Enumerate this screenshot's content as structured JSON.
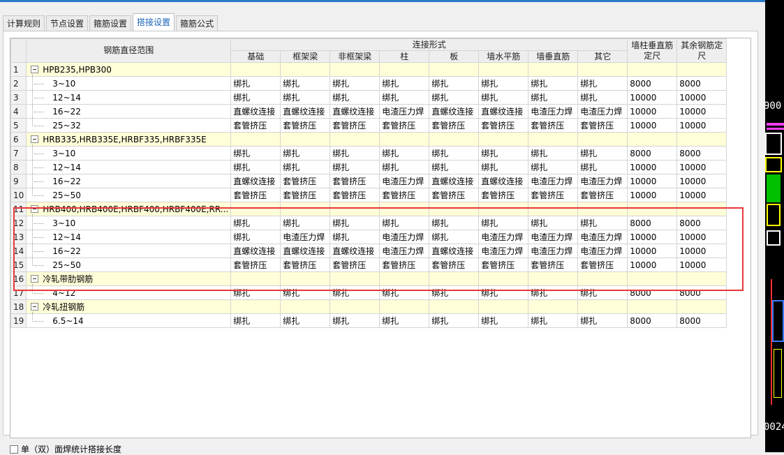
{
  "tabs": [
    {
      "label": "计算规则",
      "active": false
    },
    {
      "label": "节点设置",
      "active": false
    },
    {
      "label": "箍筋设置",
      "active": false
    },
    {
      "label": "搭接设置",
      "active": true
    },
    {
      "label": "箍筋公式",
      "active": false
    }
  ],
  "table": {
    "header": {
      "range": "钢筋直径范围",
      "group": "连接形式",
      "conn_cols": [
        "基础",
        "框架梁",
        "非框架梁",
        "柱",
        "板",
        "墙水平筋",
        "墙垂直筋",
        "其它"
      ],
      "len1": "墙柱垂直筋定尺",
      "len2": "其余钢筋定尺"
    },
    "rows": [
      {
        "n": "1",
        "type": "group",
        "label": "HPB235,HPB300"
      },
      {
        "n": "2",
        "type": "item",
        "label": "3~10",
        "cells": [
          "绑扎",
          "绑扎",
          "绑扎",
          "绑扎",
          "绑扎",
          "绑扎",
          "绑扎",
          "绑扎",
          "8000",
          "8000"
        ]
      },
      {
        "n": "3",
        "type": "item",
        "label": "12~14",
        "cells": [
          "绑扎",
          "绑扎",
          "绑扎",
          "绑扎",
          "绑扎",
          "绑扎",
          "绑扎",
          "绑扎",
          "10000",
          "10000"
        ]
      },
      {
        "n": "4",
        "type": "item",
        "label": "16~22",
        "cells": [
          "直螺纹连接",
          "直螺纹连接",
          "直螺纹连接",
          "电渣压力焊",
          "直螺纹连接",
          "直螺纹连接",
          "电渣压力焊",
          "电渣压力焊",
          "10000",
          "10000"
        ]
      },
      {
        "n": "5",
        "type": "item",
        "label": "25~32",
        "cells": [
          "套管挤压",
          "套管挤压",
          "套管挤压",
          "套管挤压",
          "套管挤压",
          "套管挤压",
          "套管挤压",
          "套管挤压",
          "10000",
          "10000"
        ]
      },
      {
        "n": "6",
        "type": "group",
        "label": "HRB335,HRB335E,HRBF335,HRBF335E"
      },
      {
        "n": "7",
        "type": "item",
        "label": "3~10",
        "cells": [
          "绑扎",
          "绑扎",
          "绑扎",
          "绑扎",
          "绑扎",
          "绑扎",
          "绑扎",
          "绑扎",
          "8000",
          "8000"
        ]
      },
      {
        "n": "8",
        "type": "item",
        "label": "12~14",
        "cells": [
          "绑扎",
          "绑扎",
          "绑扎",
          "绑扎",
          "绑扎",
          "绑扎",
          "绑扎",
          "绑扎",
          "10000",
          "10000"
        ]
      },
      {
        "n": "9",
        "type": "item",
        "label": "16~22",
        "cells": [
          "直螺纹连接",
          "套管挤压",
          "套管挤压",
          "电渣压力焊",
          "直螺纹连接",
          "直螺纹连接",
          "电渣压力焊",
          "电渣压力焊",
          "10000",
          "10000"
        ]
      },
      {
        "n": "10",
        "type": "item",
        "label": "25~50",
        "cells": [
          "套管挤压",
          "套管挤压",
          "套管挤压",
          "套管挤压",
          "套管挤压",
          "套管挤压",
          "套管挤压",
          "套管挤压",
          "10000",
          "10000"
        ]
      },
      {
        "n": "11",
        "type": "group",
        "label": "HRB400,HRB400E,HRBF400,HRBF400E,RR..."
      },
      {
        "n": "12",
        "type": "item",
        "label": "3~10",
        "cells": [
          "绑扎",
          "绑扎",
          "绑扎",
          "绑扎",
          "绑扎",
          "绑扎",
          "绑扎",
          "绑扎",
          "8000",
          "8000"
        ]
      },
      {
        "n": "13",
        "type": "item",
        "label": "12~14",
        "cells": [
          "绑扎",
          "电渣压力焊",
          "绑扎",
          "电渣压力焊",
          "绑扎",
          "电渣压力焊",
          "电渣压力焊",
          "电渣压力焊",
          "10000",
          "10000"
        ]
      },
      {
        "n": "14",
        "type": "item",
        "label": "16~22",
        "cells": [
          "直螺纹连接",
          "直螺纹连接",
          "直螺纹连接",
          "电渣压力焊",
          "直螺纹连接",
          "电渣压力焊",
          "电渣压力焊",
          "电渣压力焊",
          "10000",
          "10000"
        ]
      },
      {
        "n": "15",
        "type": "item",
        "label": "25~50",
        "cells": [
          "套管挤压",
          "套管挤压",
          "套管挤压",
          "套管挤压",
          "套管挤压",
          "套管挤压",
          "套管挤压",
          "套管挤压",
          "10000",
          "10000"
        ]
      },
      {
        "n": "16",
        "type": "group",
        "label": "冷轧带肋钢筋"
      },
      {
        "n": "17",
        "type": "item",
        "label": "4~12",
        "cells": [
          "绑扎",
          "绑扎",
          "绑扎",
          "绑扎",
          "绑扎",
          "绑扎",
          "绑扎",
          "绑扎",
          "8000",
          "8000"
        ]
      },
      {
        "n": "18",
        "type": "group",
        "label": "冷轧扭钢筋"
      },
      {
        "n": "19",
        "type": "item",
        "label": "6.5~14",
        "cells": [
          "绑扎",
          "绑扎",
          "绑扎",
          "绑扎",
          "绑扎",
          "绑扎",
          "绑扎",
          "绑扎",
          "8000",
          "8000"
        ]
      }
    ]
  },
  "footer": {
    "checkbox_label": "单（双）面焊统计搭接长度",
    "checked": false
  },
  "cad_labels": {
    "top": "900",
    "bottom": "0024"
  },
  "colors": {
    "highlight": "#e8373a",
    "group_row": "#fffed8",
    "active_tab": "#1b63b8",
    "title_bar": "#2a79c9"
  }
}
